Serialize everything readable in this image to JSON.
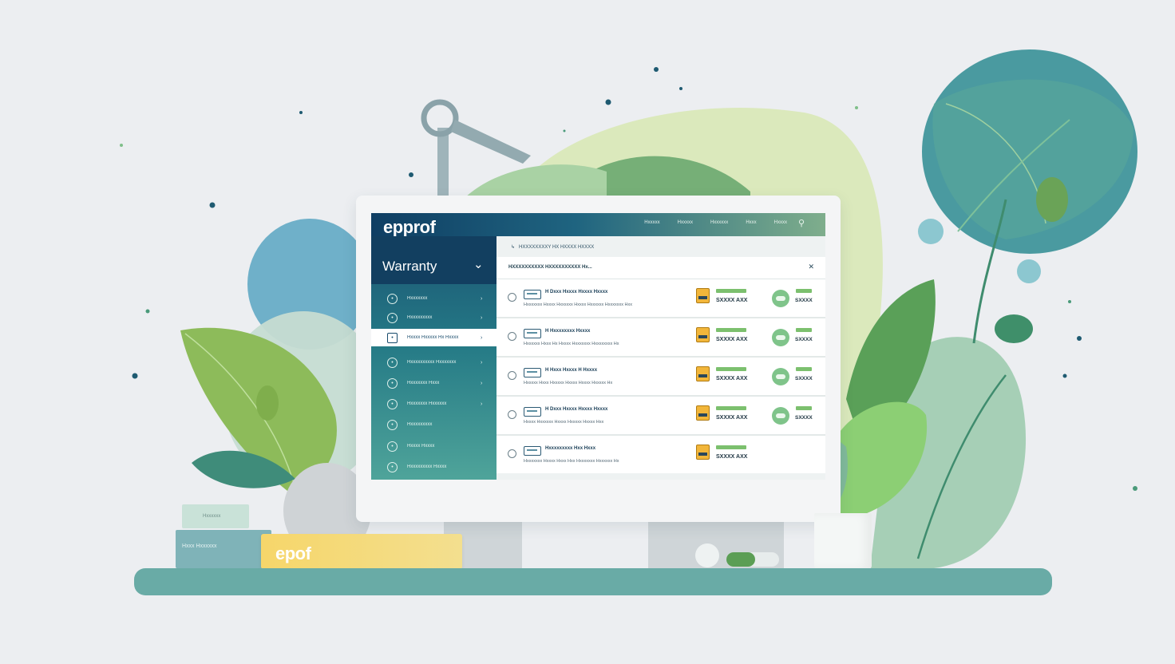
{
  "app": {
    "logo": "epprof",
    "nav": [
      "Hxxxxx",
      "Hxxxxx",
      "Hxxxxxx",
      "Hxxx",
      "Hxxxx"
    ]
  },
  "sidebar": {
    "title": "Warranty",
    "items": [
      {
        "label": "Hxxxxxxx",
        "active": false
      },
      {
        "label": "Hxxxxxxxxx",
        "active": false
      },
      {
        "label": "Hxxxx Hxxxxx Hx Hxxxx",
        "active": true
      },
      {
        "label": "Hxxxxxxxxxx Hxxxxxxx",
        "active": false
      },
      {
        "label": "Hxxxxxxx Hxxx",
        "active": false
      },
      {
        "label": "Hxxxxxxx Hxxxxxx",
        "active": false
      },
      {
        "label": "Hxxxxxxxxx",
        "active": false
      },
      {
        "label": "Hxxxx Hxxxx",
        "active": false
      },
      {
        "label": "Hxxxxxxxxx Hxxxx",
        "active": false
      }
    ]
  },
  "content": {
    "breadcrumb": "HXXXXXXXXY HX HXXXX HXXXX",
    "header": "HXXXXXXXXXX HXXXXXXXXXX Hx...",
    "rows": [
      {
        "name": "H Dxxx Hxxxx Hxxxx Hxxxx",
        "desc": "Hxxxxxxx Hxxxx Hxxxxxx Hxxxx Hxxxxxx Hxxxxxxx Hxx",
        "amount": "SXXXX AXX",
        "amount2": "SXXXX"
      },
      {
        "name": "H Hxxxxxxxx Hxxxx",
        "desc": "Hxxxxxx Hxxx Hx Hxxxx Hxxxxxxx Hxxxxxxxx Hx",
        "amount": "SXXXX AXX",
        "amount2": "SXXXX"
      },
      {
        "name": "H Hxxx Hxxxx H Hxxxx",
        "desc": "Hxxxxx Hxxx Hxxxxx Hxxxx Hxxxx Hxxxxx Hx",
        "amount": "SXXXX AXX",
        "amount2": "SXXXX"
      },
      {
        "name": "H Dxxx Hxxxx Hxxxx Hxxxx",
        "desc": "Hxxxx Hxxxxxx Hxxxx Hxxxxx Hxxxx Hxx",
        "amount": "SXXXX AXX",
        "amount2": "SXXXX"
      },
      {
        "name": "Hxxxxxxxxx Hxx Hxxx",
        "desc": "Hxxxxxxx Hxxxx Hxxx Hxx Hxxxxxxx Hxxxxxx Hx",
        "amount": "SXXXX AXX",
        "amount2": ""
      }
    ]
  },
  "books": {
    "small_label": "Hxxxxxx",
    "mid_label": "Hxxx Hxxxxxx",
    "yellow_label": "epof"
  },
  "colors": {
    "accent": "#1f6480",
    "header_dark": "#123f60",
    "green": "#7cc06e",
    "shelf": "#69aba6"
  }
}
